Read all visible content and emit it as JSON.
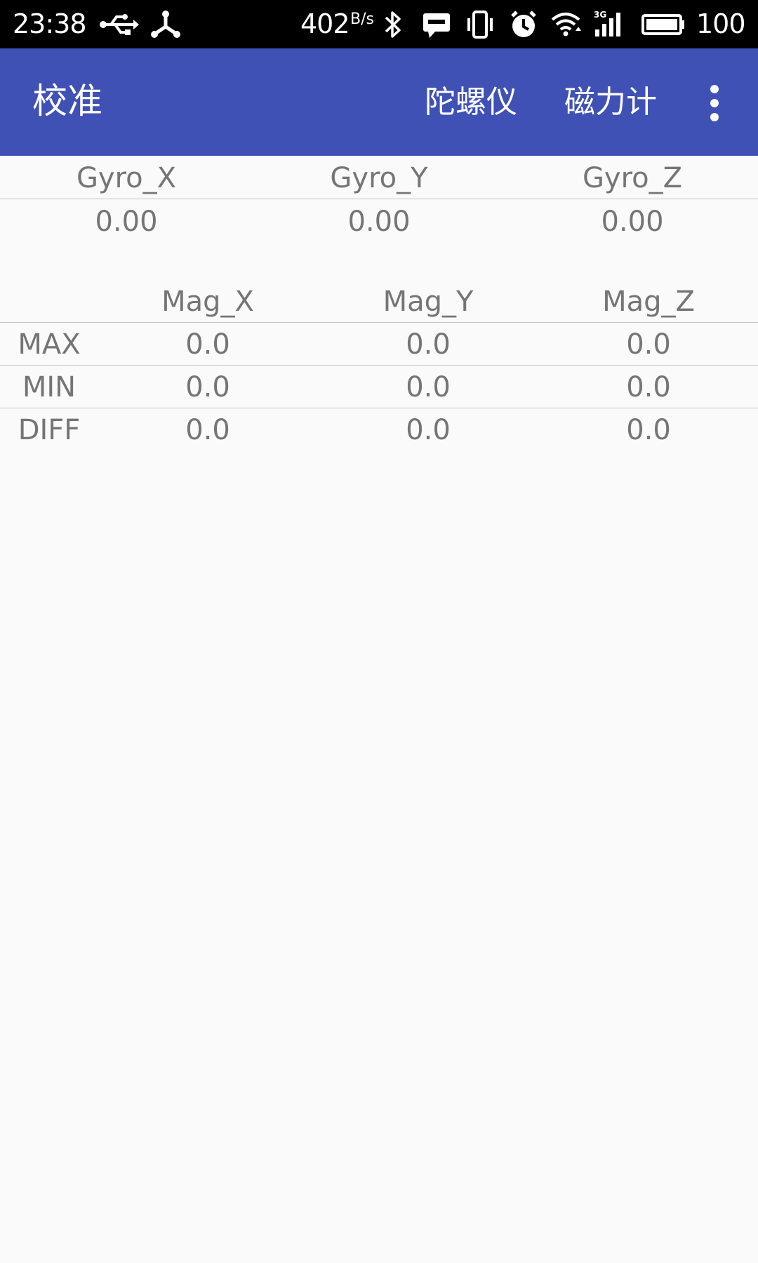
{
  "status_bar": {
    "time": "23:38",
    "net_speed": "402",
    "net_speed_unit": "B/s",
    "battery_percent": "100",
    "icons": [
      "usb-icon",
      "share-icon",
      "bluetooth-icon",
      "message-icon",
      "vibrate-icon",
      "alarm-icon",
      "wifi-icon",
      "signal-3g-icon",
      "battery-icon"
    ]
  },
  "app_bar": {
    "title": "校准",
    "actions": [
      "陀螺仪",
      "磁力计"
    ],
    "overflow_icon": "more-vert-icon",
    "color": "#3f51b5"
  },
  "gyro_table": {
    "headers": [
      "Gyro_X",
      "Gyro_Y",
      "Gyro_Z"
    ],
    "values": [
      "0.00",
      "0.00",
      "0.00"
    ]
  },
  "mag_table": {
    "headers": [
      "Mag_X",
      "Mag_Y",
      "Mag_Z"
    ],
    "rows": [
      {
        "label": "MAX",
        "values": [
          "0.0",
          "0.0",
          "0.0"
        ]
      },
      {
        "label": "MIN",
        "values": [
          "0.0",
          "0.0",
          "0.0"
        ]
      },
      {
        "label": "DIFF",
        "values": [
          "0.0",
          "0.0",
          "0.0"
        ]
      }
    ]
  }
}
